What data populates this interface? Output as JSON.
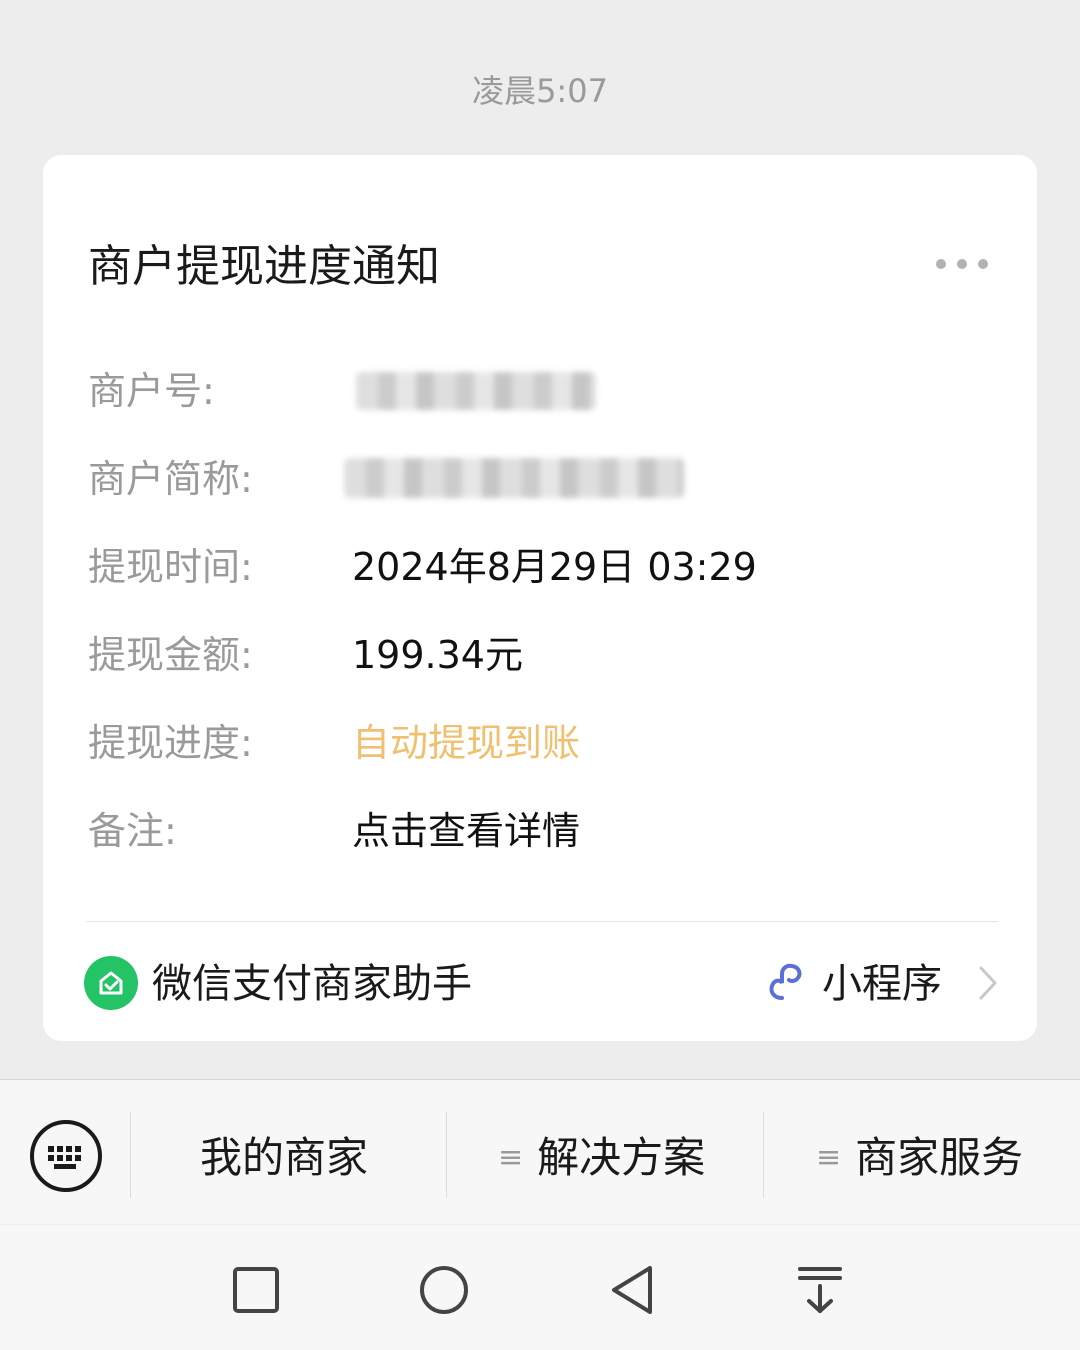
{
  "timestamp": "凌晨5:07",
  "card": {
    "title": "商户提现进度通知",
    "rows": [
      {
        "label": "商户号:",
        "value": ""
      },
      {
        "label": "商户简称:",
        "value": ""
      },
      {
        "label": "提现时间:",
        "value": "2024年8月29日 03:29"
      },
      {
        "label": "提现金额:",
        "value": "199.34元"
      },
      {
        "label": "提现进度:",
        "value": "自动提现到账"
      },
      {
        "label": "备注:",
        "value": "点击查看详情"
      }
    ],
    "footer": {
      "app_name": "微信支付商家助手",
      "mini_program_label": "小程序"
    }
  },
  "menu": {
    "items": [
      {
        "label": "我的商家"
      },
      {
        "label": "解决方案",
        "hamburger": "≡"
      },
      {
        "label": "商家服务",
        "hamburger": "≡"
      }
    ]
  },
  "colors": {
    "progress_text": "#f0c070",
    "app_icon_bg": "#23c366",
    "mini_program_icon": "#5b6fd6"
  }
}
